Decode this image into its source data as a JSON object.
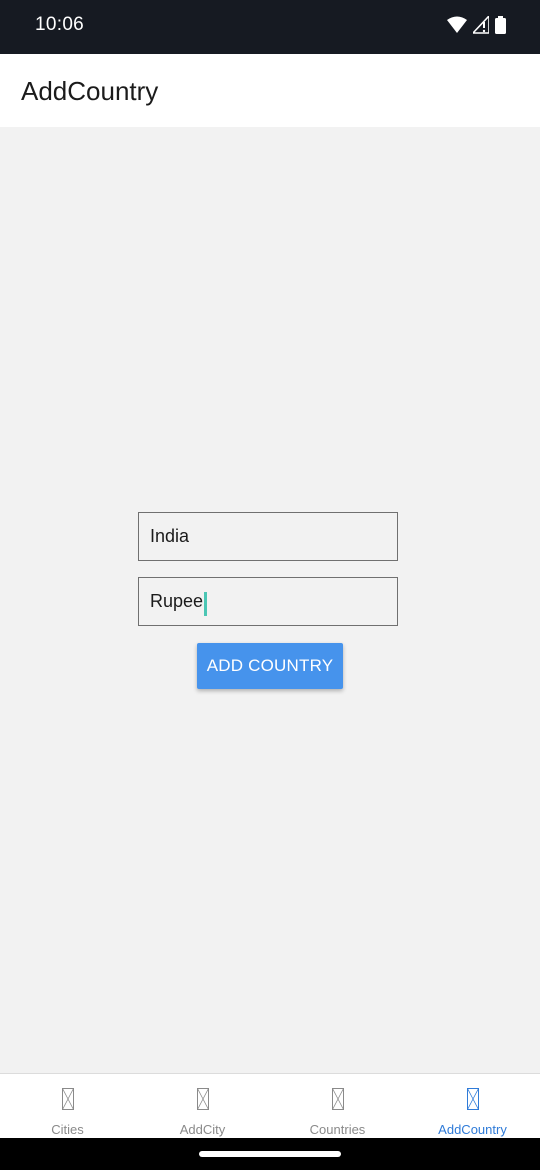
{
  "status_bar": {
    "time": "10:06",
    "icons": [
      "wifi-icon",
      "signal-icon",
      "battery-icon"
    ]
  },
  "header": {
    "title": "AddCountry"
  },
  "form": {
    "country_name_value": "India",
    "currency_value": "Rupee",
    "submit_label": "ADD COUNTRY"
  },
  "tabs": [
    {
      "label": "Cities",
      "icon": "missing-image-icon",
      "active": false
    },
    {
      "label": "AddCity",
      "icon": "missing-image-icon",
      "active": false
    },
    {
      "label": "Countries",
      "icon": "missing-image-icon",
      "active": false
    },
    {
      "label": "AddCountry",
      "icon": "missing-image-icon",
      "active": true
    }
  ],
  "colors": {
    "status_bar_bg": "#161a22",
    "accent": "#4693ec",
    "active_tab": "#2f7bd8",
    "caret": "#4bc6b4"
  }
}
